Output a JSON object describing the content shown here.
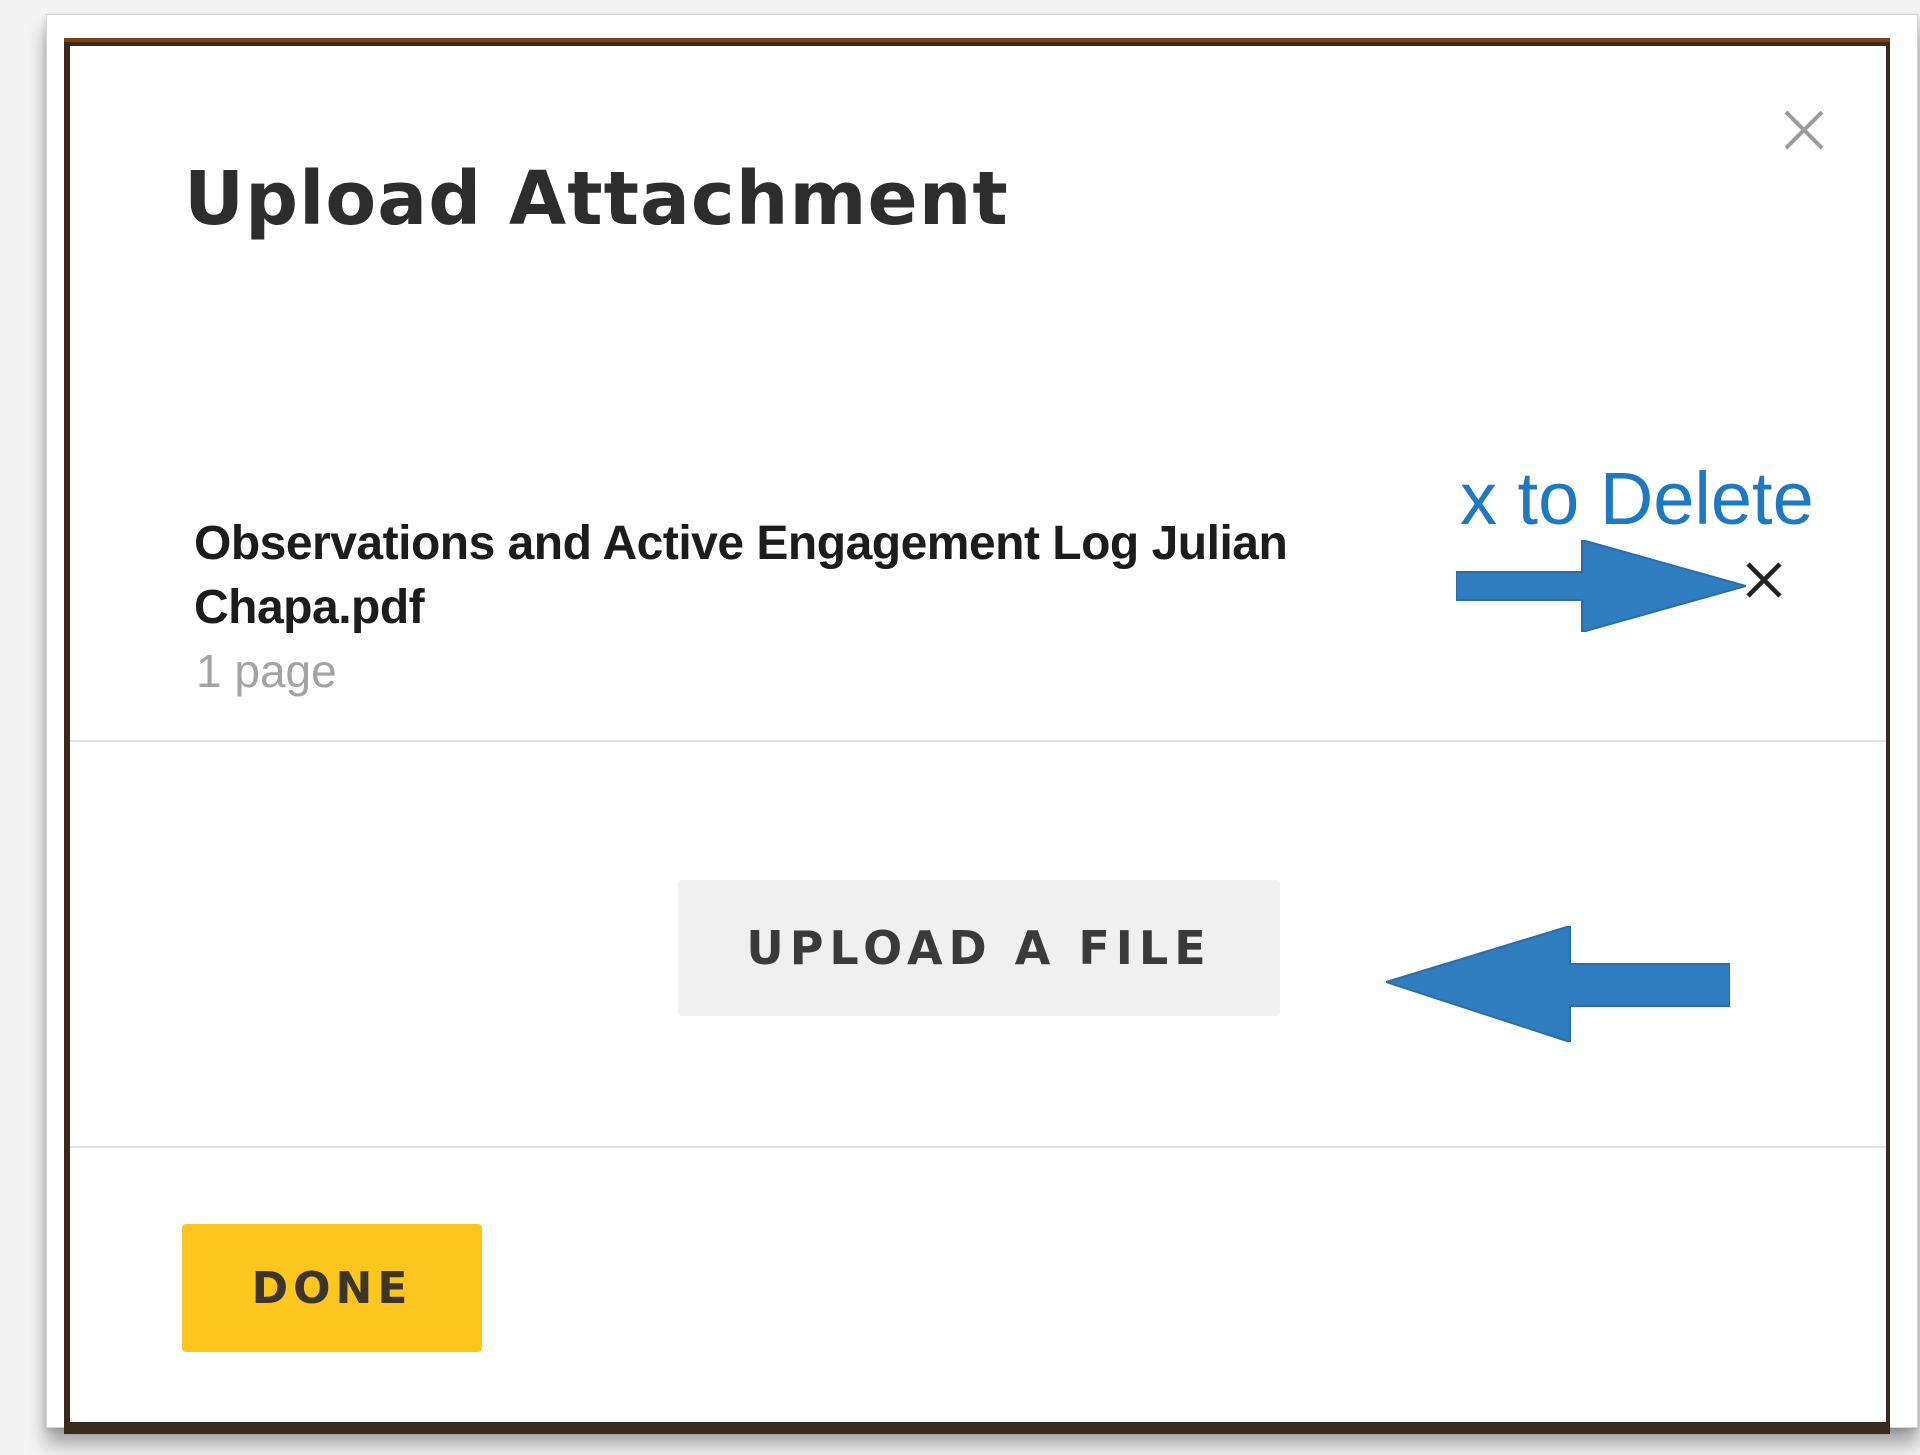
{
  "dialog": {
    "title": "Upload Attachment",
    "close_icon": "close-icon"
  },
  "attachment": {
    "file_name": "Observations and Active Engagement Log Julian Chapa.pdf",
    "pages": "1 page",
    "delete_icon": "close-icon"
  },
  "annotations": {
    "delete_hint": "x to Delete",
    "arrow_color": "#2f7cbf"
  },
  "actions": {
    "upload_label": "UPLOAD A FILE",
    "done_label": "DONE"
  },
  "colors": {
    "done_button": "#fcc61f",
    "upload_button": "#f0f0f0",
    "annotation_text": "#1e78c2"
  }
}
